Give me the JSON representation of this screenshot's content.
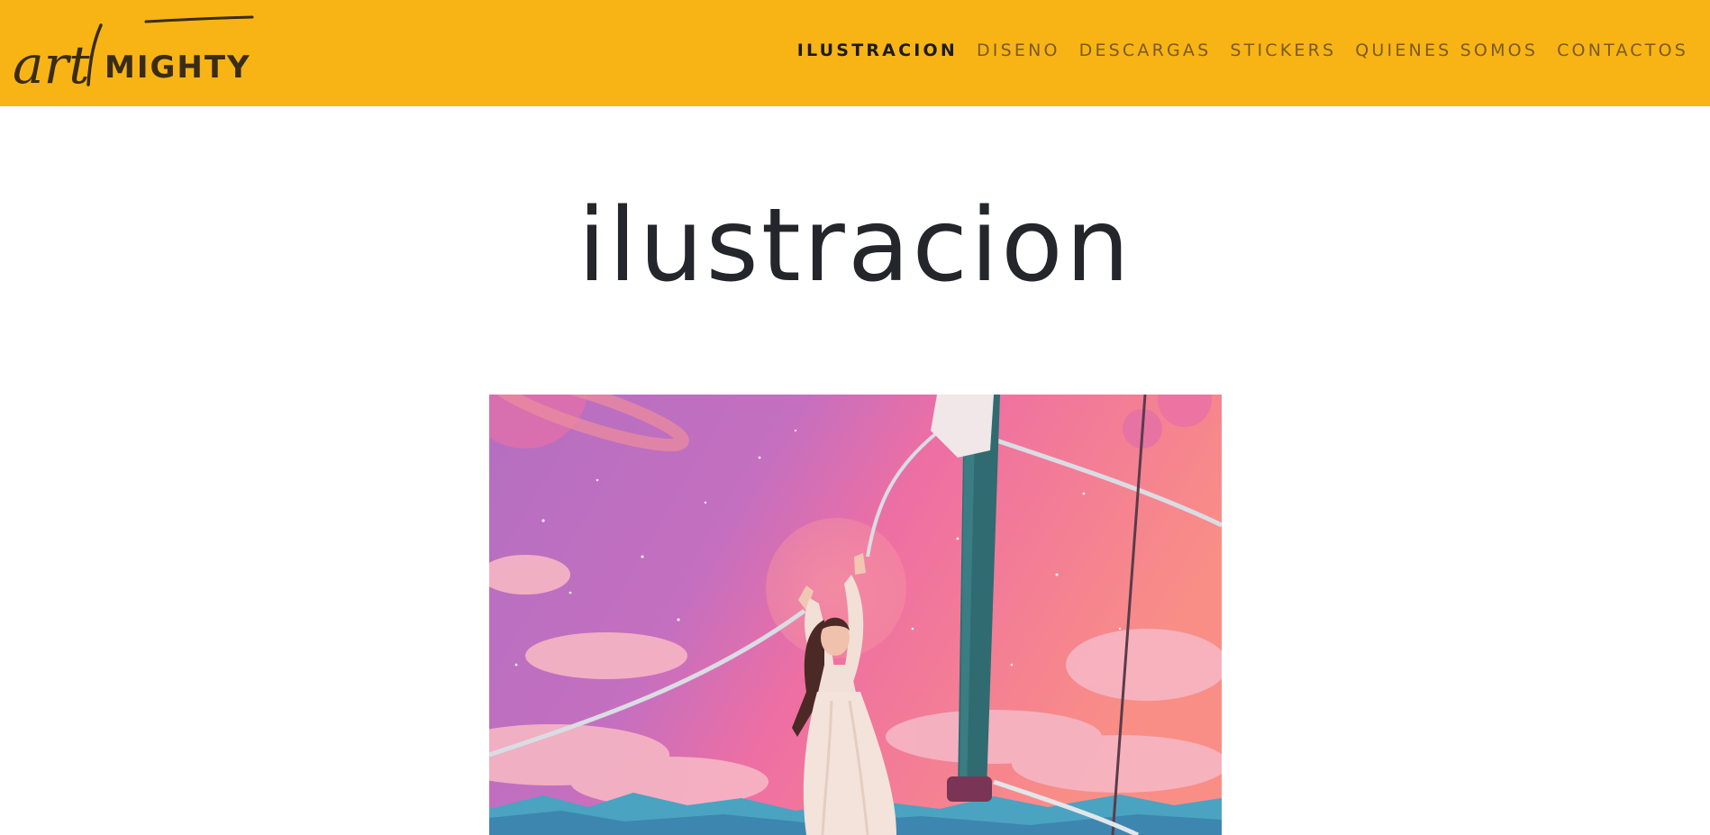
{
  "header": {
    "background": "#f8b415",
    "logo": {
      "script_text": "art",
      "bold_text": "MIGHTY",
      "color": "#3a2c14"
    },
    "nav": [
      {
        "label": "ILUSTRACION",
        "active": true
      },
      {
        "label": "DISENO",
        "active": false
      },
      {
        "label": "DESCARGAS",
        "active": false
      },
      {
        "label": "STICKERS",
        "active": false
      },
      {
        "label": "QUIENES SOMOS",
        "active": false
      },
      {
        "label": "CONTACTOS",
        "active": false
      }
    ]
  },
  "main": {
    "title": "ilustracion",
    "artwork": {
      "icon": "illustration-girl-on-sailboat",
      "colors": {
        "sky_purple": "#b46fc0",
        "sky_pink": "#ee6fa3",
        "sky_coral": "#f98e86",
        "sea_blue": "#4aa3c0",
        "mast_teal": "#2f6b71"
      }
    }
  }
}
